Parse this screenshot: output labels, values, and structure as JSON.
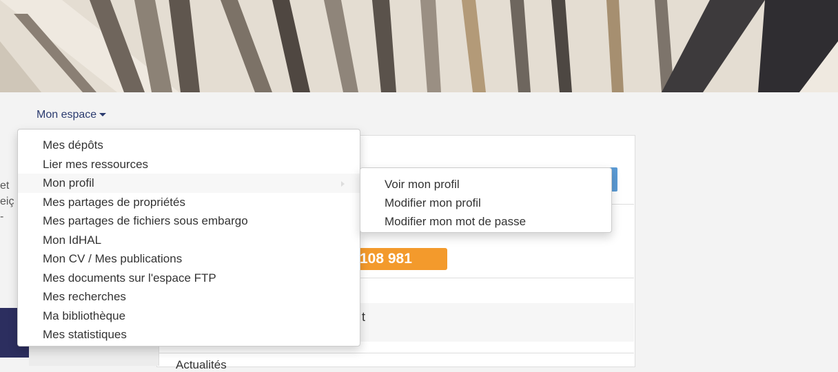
{
  "menu": {
    "trigger_label": "Mon espace",
    "items": [
      {
        "label": "Mes dépôts"
      },
      {
        "label": "Lier mes ressources"
      },
      {
        "label": "Mon profil"
      },
      {
        "label": "Mes partages de propriétés"
      },
      {
        "label": "Mes partages de fichiers sous embargo"
      },
      {
        "label": "Mon IdHAL"
      },
      {
        "label": "Mon CV / Mes publications"
      },
      {
        "label": "Mes documents sur l'espace FTP"
      },
      {
        "label": "Mes recherches"
      },
      {
        "label": "Ma bibliothèque"
      },
      {
        "label": "Mes statistiques"
      }
    ],
    "submenu": {
      "items": [
        {
          "label": "Voir mon profil"
        },
        {
          "label": "Modifier mon profil"
        },
        {
          "label": "Modifier mon mot de passe"
        }
      ]
    }
  },
  "background": {
    "counter": "108 981",
    "left_fragments": [
      "et",
      "eiç",
      "-"
    ],
    "partial_text": "t",
    "actualites": "Actualités"
  },
  "colors": {
    "trigger_text": "#2b3b6f",
    "counter_bg": "#f39a2c",
    "blue_button": "#5b9bd5",
    "navy_block": "#2c2e5f"
  }
}
